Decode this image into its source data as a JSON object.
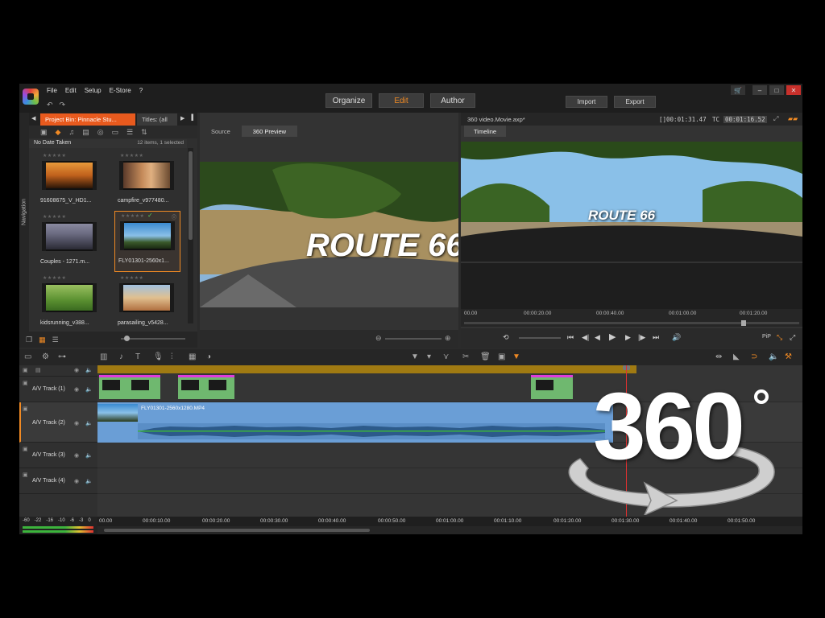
{
  "menu": [
    "File",
    "Edit",
    "Setup",
    "E-Store",
    "?"
  ],
  "modes": {
    "organize": "Organize",
    "edit": "Edit",
    "author": "Author"
  },
  "actions": {
    "import": "Import",
    "export": "Export"
  },
  "colors": {
    "accent": "#f08a24",
    "tab_active": "#e85a1e",
    "title_clip": "#6fb86f",
    "video_clip": "#6a9ed6",
    "playhead": "#e03030"
  },
  "library": {
    "nav_label": "Navigation",
    "tabs": [
      "Project Bin: Pinnacle Stu...",
      "Titles: (all"
    ],
    "group": "No Date Taken",
    "count": "12 items, 1 selected",
    "clips": [
      {
        "name": "91608675_V_HD1...",
        "selected": false
      },
      {
        "name": "campfire_v977480...",
        "selected": false
      },
      {
        "name": "Couples - 1271.m...",
        "selected": false
      },
      {
        "name": "FLY01301-2560x1...",
        "selected": true
      },
      {
        "name": "kidsrunning_v388...",
        "selected": false
      },
      {
        "name": "parasailing_v5428...",
        "selected": false
      }
    ]
  },
  "source": {
    "tabs": [
      "Source",
      "360 Preview"
    ],
    "overlay_text": "ROUTE 66"
  },
  "player": {
    "title": "360 video.Movie.axp*",
    "duration": "[]00:01:31.47",
    "tc_label": "TC",
    "timecode": "00:01:16.52",
    "tab": "Timeline",
    "overlay_text": "ROUTE 66",
    "ruler": [
      "00.00",
      "00:00:20.00",
      "00:00:40.00",
      "00:01:00.00",
      "00:01:20.00"
    ],
    "pip": "PiP"
  },
  "timeline": {
    "tracks": [
      {
        "name": "A/V Track (1)"
      },
      {
        "name": "A/V Track (2)"
      },
      {
        "name": "A/V Track (3)"
      },
      {
        "name": "A/V Track (4)"
      }
    ],
    "clip_label": "FLY01301-2560x1280.MP4",
    "ruler": [
      "00.00",
      "00:00:10.00",
      "00:00:20.00",
      "00:00:30.00",
      "00:00:40.00",
      "00:00:50.00",
      "00:01:00.00",
      "00:01:10.00",
      "00:01:20.00",
      "00:01:30.00",
      "00:01:40.00",
      "00:01:50.00"
    ],
    "meter_labels": [
      "-60",
      "-22",
      "-16",
      "-10",
      "-6",
      "-3",
      "0"
    ]
  },
  "badge": {
    "text": "360"
  }
}
